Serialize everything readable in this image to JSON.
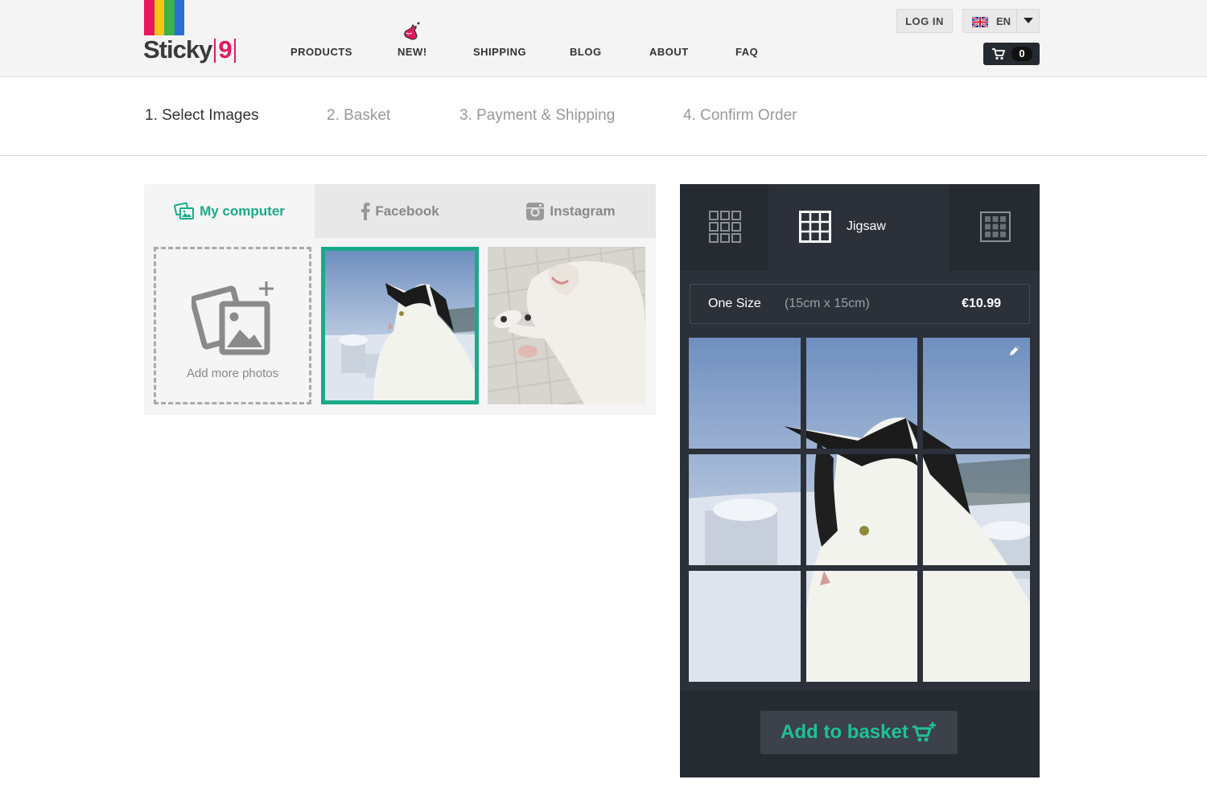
{
  "brand": {
    "name": "Sticky",
    "number": "9",
    "bar_colors": [
      "#e8175d",
      "#f7c513",
      "#3db14a",
      "#2a6fd1"
    ]
  },
  "nav": {
    "items": [
      "PRODUCTS",
      "NEW!",
      "SHIPPING",
      "BLOG",
      "ABOUT",
      "FAQ"
    ]
  },
  "header": {
    "login_label": "LOG IN",
    "language": "EN",
    "cart_count": "0"
  },
  "steps": [
    "1. Select Images",
    "2. Basket",
    "3. Payment & Shipping",
    "4. Confirm Order"
  ],
  "source": {
    "tabs": [
      "My computer",
      "Facebook",
      "Instagram"
    ],
    "add_label": "Add more photos"
  },
  "product": {
    "active_tab_label": "Jigsaw",
    "size_name": "One Size",
    "size_dims": "(15cm x 15cm)",
    "price": "€10.99",
    "add_to_basket": "Add to basket"
  },
  "colors": {
    "accent": "#1aaa8a",
    "panel_dark": "#2c3038",
    "cart_dark": "#252a30"
  }
}
